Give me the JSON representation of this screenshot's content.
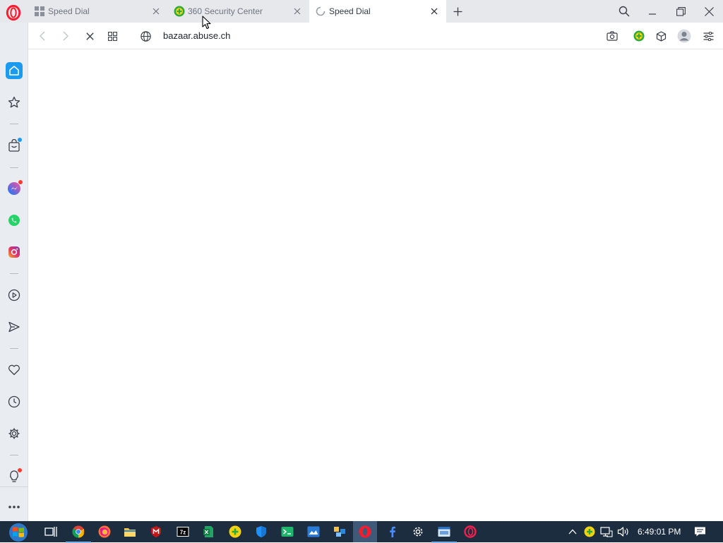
{
  "browser": {
    "tabs": [
      {
        "label": "Speed Dial",
        "active": false,
        "favicon": "speed-dial-grid-icon"
      },
      {
        "label": "360 Security Center",
        "active": false,
        "favicon": "360-security-icon"
      },
      {
        "label": "Speed Dial",
        "active": true,
        "favicon": "loading-spinner-icon"
      }
    ],
    "url": "bazaar.abuse.ch",
    "accent_color": "#ff1b2d",
    "sidebar_accent": "#1a9bf0"
  },
  "sidebar": {
    "items": [
      "home-icon",
      "bookmarks-star-icon",
      "shopping-bag-icon",
      "messenger-icon",
      "whatsapp-icon",
      "instagram-icon",
      "player-icon",
      "send-icon",
      "heart-icon",
      "history-clock-icon",
      "settings-gear-icon",
      "lightbulb-icon",
      "more-dots-icon"
    ]
  },
  "toolbar": {
    "icons": [
      "back-icon",
      "forward-icon",
      "stop-loading-icon",
      "tab-grid-icon",
      "globe-icon",
      "camera-snapshot-icon",
      "360-extension-icon",
      "cube-extension-icon",
      "profile-avatar-icon",
      "easy-setup-icon"
    ]
  },
  "taskbar": {
    "clock": "6:49:01 PM",
    "apps": [
      "task-view-icon",
      "chrome-icon",
      "firefox-icon",
      "file-explorer-icon",
      "mcafee-icon",
      "7zip-icon",
      "excel-icon",
      "360-total-security-icon",
      "windows-defender-icon",
      "terminal-icon",
      "image-editor-icon",
      "network-icon",
      "opera-icon",
      "facebook-icon",
      "settings-icon",
      "window-icon",
      "opera-gx-icon"
    ],
    "tray": [
      "show-hidden-chevron-icon",
      "360-tray-icon",
      "network-tray-icon",
      "volume-icon",
      "notification-icon"
    ]
  }
}
